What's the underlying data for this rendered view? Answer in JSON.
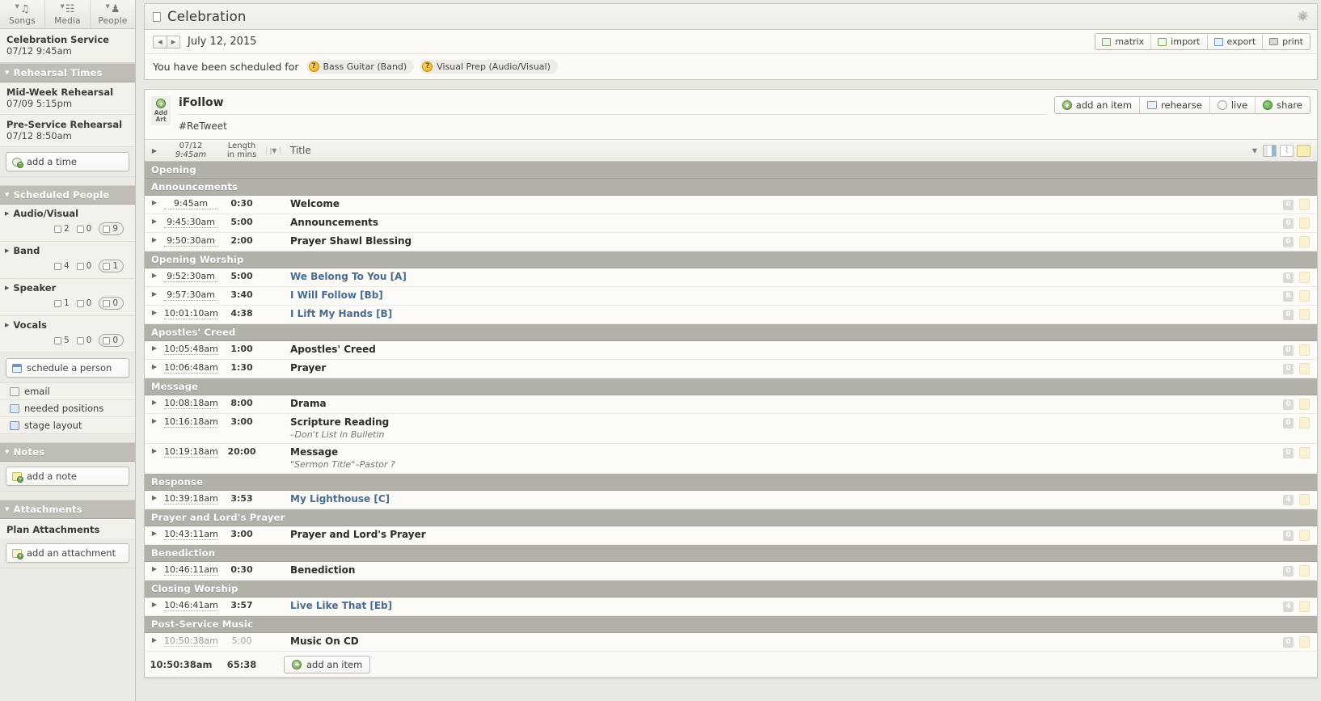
{
  "sidebar": {
    "tabs": [
      {
        "label": "Songs",
        "icon": "music-note-icon",
        "glyph": "♫"
      },
      {
        "label": "Media",
        "icon": "film-strip-icon",
        "glyph": "☷"
      },
      {
        "label": "People",
        "icon": "person-icon",
        "glyph": "♟"
      }
    ],
    "service": {
      "name": "Celebration Service",
      "datetime": "07/12 9:45am"
    },
    "rehearsal_section": {
      "title": "Rehearsal Times",
      "collapse_icon": "triangle-down-icon"
    },
    "rehearsals": [
      {
        "name": "Mid-Week Rehearsal",
        "datetime": "07/09 5:15pm"
      },
      {
        "name": "Pre-Service Rehearsal",
        "datetime": "07/12 8:50am"
      }
    ],
    "add_time_label": "add a time",
    "scheduled_section": {
      "title": "Scheduled People",
      "collapse_icon": "triangle-down-icon"
    },
    "people_groups": [
      {
        "name": "Audio/Visual",
        "confirmed": "2",
        "declined": "0",
        "pending": "9"
      },
      {
        "name": "Band",
        "confirmed": "4",
        "declined": "0",
        "pending": "1"
      },
      {
        "name": "Speaker",
        "confirmed": "1",
        "declined": "0",
        "pending": "0"
      },
      {
        "name": "Vocals",
        "confirmed": "5",
        "declined": "0",
        "pending": "0"
      }
    ],
    "schedule_person_label": "schedule a person",
    "people_links": [
      {
        "label": "email",
        "icon": "envelope-icon"
      },
      {
        "label": "needed positions",
        "icon": "people-icon"
      },
      {
        "label": "stage layout",
        "icon": "stage-icon"
      }
    ],
    "notes_section": {
      "title": "Notes"
    },
    "add_note_label": "add a note",
    "attachments_section": {
      "title": "Attachments"
    },
    "plan_attachments_label": "Plan Attachments",
    "add_attachment_label": "add an attachment"
  },
  "header": {
    "title": "Celebration",
    "title_icon": "plan-icon",
    "gear_icon": "gear-icon"
  },
  "datebar": {
    "prev_icon": "triangle-left-icon",
    "next_icon": "triangle-right-icon",
    "date": "July 12, 2015",
    "actions": [
      {
        "label": "matrix",
        "icon": "matrix-icon"
      },
      {
        "label": "import",
        "icon": "import-icon"
      },
      {
        "label": "export",
        "icon": "export-icon"
      },
      {
        "label": "print",
        "icon": "printer-icon"
      }
    ]
  },
  "scheduled_for": {
    "label": "You have been scheduled for",
    "chips": [
      {
        "label": "Bass Guitar (Band)",
        "status_icon": "question-mark-icon"
      },
      {
        "label": "Visual Prep (Audio/Visual)",
        "status_icon": "question-mark-icon"
      }
    ]
  },
  "plan": {
    "add_art_label_line1": "Add",
    "add_art_label_line2": "Art",
    "add_art_icon": "plus-circle-green-icon",
    "name": "iFollow",
    "tag": "#ReTweet",
    "actions": [
      {
        "label": "add an item",
        "icon": "plus-circle-green-icon"
      },
      {
        "label": "rehearse",
        "icon": "book-icon"
      },
      {
        "label": "live",
        "icon": "live-circle-icon"
      },
      {
        "label": "share",
        "icon": "share-circle-icon"
      }
    ],
    "columns": {
      "expand_icon": "triangle-right-icon",
      "time_line1": "07/12",
      "time_line2": "9:45am",
      "length_line1": "Length",
      "length_line2": "in mins",
      "sort_icon": "sort-arrow-icon",
      "title": "Title"
    },
    "header_icons": [
      {
        "name": "caret-down-icon"
      },
      {
        "name": "column-layout-icon"
      },
      {
        "name": "attachment-icon"
      },
      {
        "name": "note-icon"
      }
    ],
    "rows": [
      {
        "kind": "group",
        "title": "Opening"
      },
      {
        "kind": "group",
        "title": "Announcements"
      },
      {
        "kind": "item",
        "time": "9:45am",
        "length": "0:30",
        "title": "Welcome",
        "song": false,
        "badge": "0"
      },
      {
        "kind": "item",
        "time": "9:45:30am",
        "length": "5:00",
        "title": "Announcements",
        "song": false,
        "badge": "0"
      },
      {
        "kind": "item",
        "time": "9:50:30am",
        "length": "2:00",
        "title": "Prayer Shawl Blessing",
        "song": false,
        "badge": "0"
      },
      {
        "kind": "group",
        "title": "Opening Worship"
      },
      {
        "kind": "item",
        "time": "9:52:30am",
        "length": "5:00",
        "title": "We Belong To You [A]",
        "song": true,
        "badge": "6"
      },
      {
        "kind": "item",
        "time": "9:57:30am",
        "length": "3:40",
        "title": "I Will Follow [Bb]",
        "song": true,
        "badge": "8"
      },
      {
        "kind": "item",
        "time": "10:01:10am",
        "length": "4:38",
        "title": "I Lift My Hands [B]",
        "song": true,
        "badge": "8"
      },
      {
        "kind": "group",
        "title": "Apostles' Creed"
      },
      {
        "kind": "item",
        "time": "10:05:48am",
        "length": "1:00",
        "title": "Apostles' Creed",
        "song": false,
        "badge": "0"
      },
      {
        "kind": "item",
        "time": "10:06:48am",
        "length": "1:30",
        "title": "Prayer",
        "song": false,
        "badge": "0"
      },
      {
        "kind": "group",
        "title": "Message"
      },
      {
        "kind": "item",
        "time": "10:08:18am",
        "length": "8:00",
        "title": "Drama",
        "song": false,
        "badge": "0"
      },
      {
        "kind": "item",
        "time": "10:16:18am",
        "length": "3:00",
        "title": "Scripture Reading",
        "subtitle": "–Don't List in Bulletin",
        "song": false,
        "badge": "0"
      },
      {
        "kind": "item",
        "time": "10:19:18am",
        "length": "20:00",
        "title": "Message",
        "subtitle": "\"Sermon Title\"–Pastor ?",
        "song": false,
        "badge": "0"
      },
      {
        "kind": "group",
        "title": "Response"
      },
      {
        "kind": "item",
        "time": "10:39:18am",
        "length": "3:53",
        "title": "My Lighthouse [C]",
        "song": true,
        "badge": "4"
      },
      {
        "kind": "group",
        "title": "Prayer and Lord's Prayer"
      },
      {
        "kind": "item",
        "time": "10:43:11am",
        "length": "3:00",
        "title": "Prayer and Lord's Prayer",
        "song": false,
        "badge": "0"
      },
      {
        "kind": "group",
        "title": "Benediction"
      },
      {
        "kind": "item",
        "time": "10:46:11am",
        "length": "0:30",
        "title": "Benediction",
        "song": false,
        "badge": "0"
      },
      {
        "kind": "group",
        "title": "Closing Worship"
      },
      {
        "kind": "item",
        "time": "10:46:41am",
        "length": "3:57",
        "title": "Live Like That [Eb]",
        "song": true,
        "badge": "4"
      },
      {
        "kind": "group",
        "title": "Post-Service Music"
      },
      {
        "kind": "item",
        "time": "10:50:38am",
        "length": "5:00",
        "title": "Music On CD",
        "song": false,
        "dim": true,
        "badge": "0"
      }
    ],
    "footer": {
      "time": "10:50:38am",
      "total_length": "65:38",
      "add_item_label": "add an item",
      "add_item_icon": "plus-circle-green-icon"
    }
  }
}
